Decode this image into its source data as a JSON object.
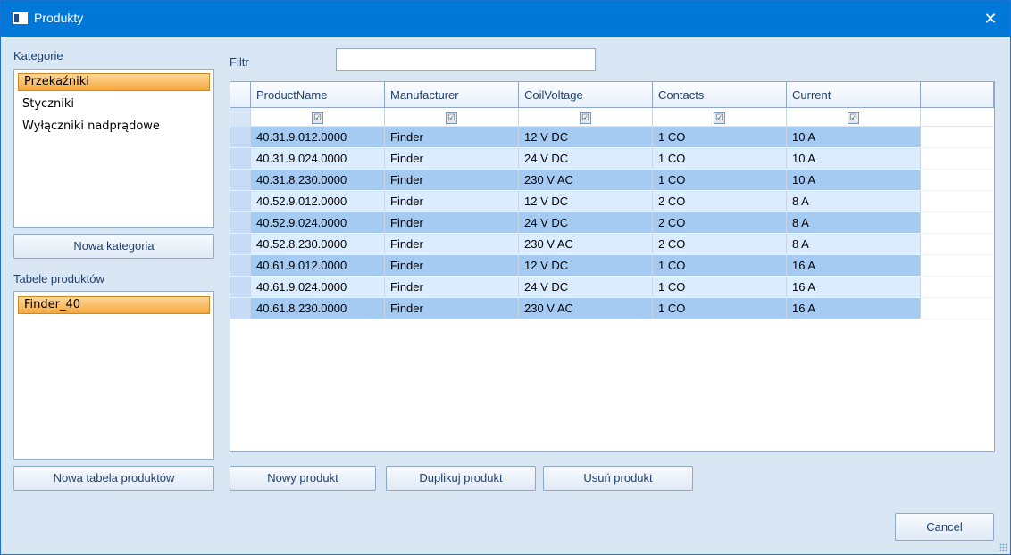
{
  "window": {
    "title": "Produkty"
  },
  "categories": {
    "label": "Kategorie",
    "items": [
      "Przekaźniki",
      "Styczniki",
      "Wyłączniki nadprądowe"
    ],
    "add_button": "Nowa kategoria"
  },
  "product_tables": {
    "label": "Tabele produktów",
    "items": [
      "Finder_40"
    ],
    "add_button": "Nowa tabela produktów"
  },
  "filter": {
    "label": "Filtr",
    "value": ""
  },
  "grid": {
    "columns": [
      "ProductName",
      "Manufacturer",
      "CoilVoltage",
      "Contacts",
      "Current"
    ],
    "filter_check": "☑",
    "rows": [
      [
        "40.31.9.012.0000",
        "Finder",
        "12 V DC",
        "1 CO",
        "10 A"
      ],
      [
        "40.31.9.024.0000",
        "Finder",
        "24 V DC",
        "1 CO",
        "10 A"
      ],
      [
        "40.31.8.230.0000",
        "Finder",
        "230 V AC",
        "1 CO",
        "10 A"
      ],
      [
        "40.52.9.012.0000",
        "Finder",
        "12 V DC",
        "2 CO",
        "8 A"
      ],
      [
        "40.52.9.024.0000",
        "Finder",
        "24 V DC",
        "2 CO",
        "8 A"
      ],
      [
        "40.52.8.230.0000",
        "Finder",
        "230 V AC",
        "2 CO",
        "8 A"
      ],
      [
        "40.61.9.012.0000",
        "Finder",
        "12 V DC",
        "1 CO",
        "16 A"
      ],
      [
        "40.61.9.024.0000",
        "Finder",
        "24 V DC",
        "1 CO",
        "16 A"
      ],
      [
        "40.61.8.230.0000",
        "Finder",
        "230 V AC",
        "1 CO",
        "16 A"
      ]
    ]
  },
  "actions": {
    "new_product": "Nowy produkt",
    "duplicate_product": "Duplikuj produkt",
    "delete_product": "Usuń produkt",
    "cancel": "Cancel"
  },
  "icons": {
    "app": "window-icon",
    "close": "✕"
  }
}
